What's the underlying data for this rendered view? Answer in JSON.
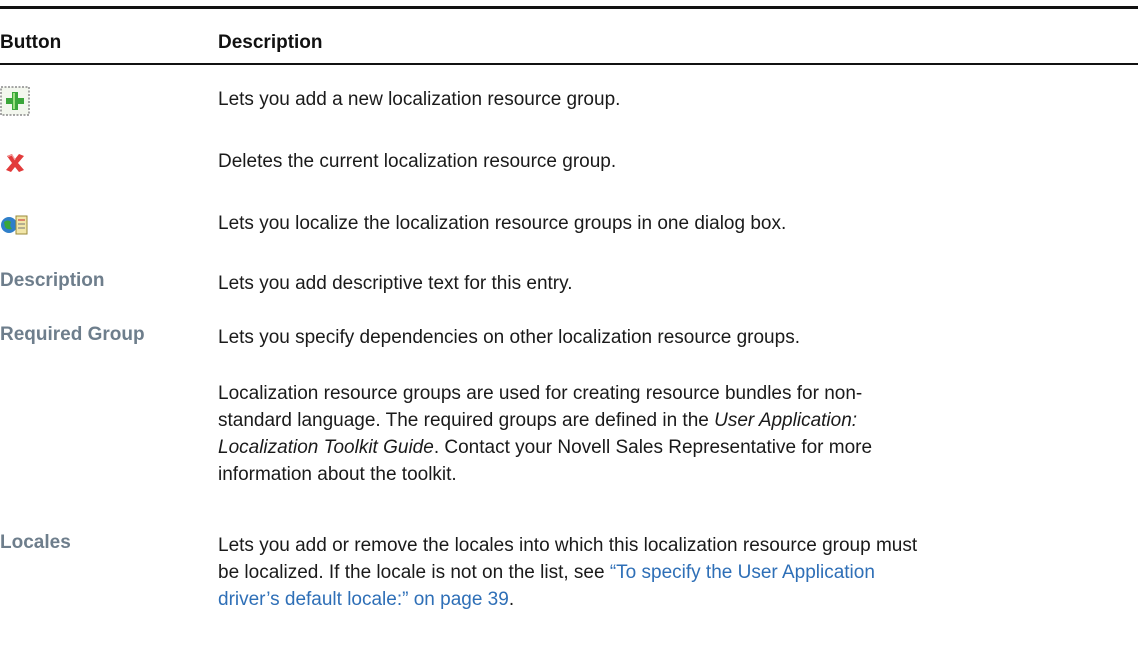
{
  "table": {
    "headers": {
      "button": "Button",
      "description": "Description"
    },
    "icon_rows": [
      {
        "icon": "add-icon",
        "text": "Lets you add a new localization resource group."
      },
      {
        "icon": "delete-icon",
        "text": "Deletes the current localization resource group."
      },
      {
        "icon": "localize-icon",
        "text": "Lets you localize the localization resource groups in one dialog box."
      }
    ],
    "description_row": {
      "label": "Description",
      "text": "Lets you add descriptive text for this entry."
    },
    "required_group_row": {
      "label": "Required Group",
      "text": "Lets you specify dependencies on other localization resource groups.",
      "note_line1": "Localization resource groups are used for creating resource bundles for non-",
      "note_line2_a": "standard language. The required groups are defined in the ",
      "note_line2_em": "User Application:",
      "note_line3_em": "Localization Toolkit Guide",
      "note_line3_b": ". Contact your Novell Sales Representative for more",
      "note_line4": "information about the toolkit."
    },
    "locales_row": {
      "label": "Locales",
      "line1": "Lets you add or remove the locales into which this localization resource group must",
      "line2_a": "be localized. If the locale is not on the list, see ",
      "link_line2": "“To specify the User Application",
      "link_line3": "driver’s default locale:” on page 39",
      "line3_b": "."
    }
  },
  "colors": {
    "label": "#6e7e8c",
    "link": "#2e6fb7",
    "add_green": "#3aa63a",
    "delete_red": "#e23b3b"
  }
}
